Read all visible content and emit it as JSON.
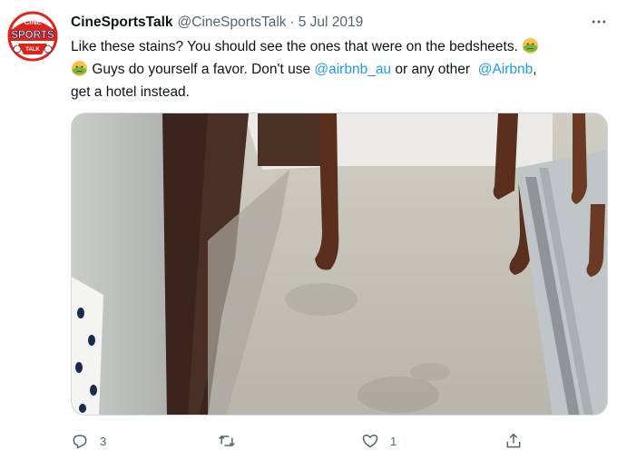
{
  "tweet": {
    "avatar_icon": "cine-sports-talk-logo",
    "avatar_text": {
      "top": "CINE",
      "middle": "SPORTS",
      "bottom": "TALK"
    },
    "display_name": "CineSportsTalk",
    "handle": "@CineSportsTalk",
    "separator": "·",
    "date": "5 Jul 2019",
    "more_icon": "more-horizontal-icon",
    "text": {
      "line1": "Like these stains? You should see the ones that were on the bedsheets.",
      "line2_part1": "Guys do yourself a favor. Don't use",
      "mention1": "@airbnb_au",
      "line2_part2": "or any other",
      "mention2": "@Airbnb",
      "line2_part3": ",",
      "line3": "get a hotel instead.",
      "emoji_icon": "nauseated-face-emoji"
    },
    "media": {
      "description_icon": "photo-carpet-furniture-legs"
    },
    "actions": {
      "reply": {
        "icon": "reply-icon",
        "count": "3"
      },
      "retweet": {
        "icon": "retweet-icon",
        "count": ""
      },
      "like": {
        "icon": "heart-icon",
        "count": "1"
      },
      "share": {
        "icon": "share-icon",
        "count": ""
      }
    },
    "colors": {
      "text": "#0f1419",
      "secondary": "#536471",
      "link": "#1d9bf0",
      "border": "#cfd9de"
    }
  }
}
